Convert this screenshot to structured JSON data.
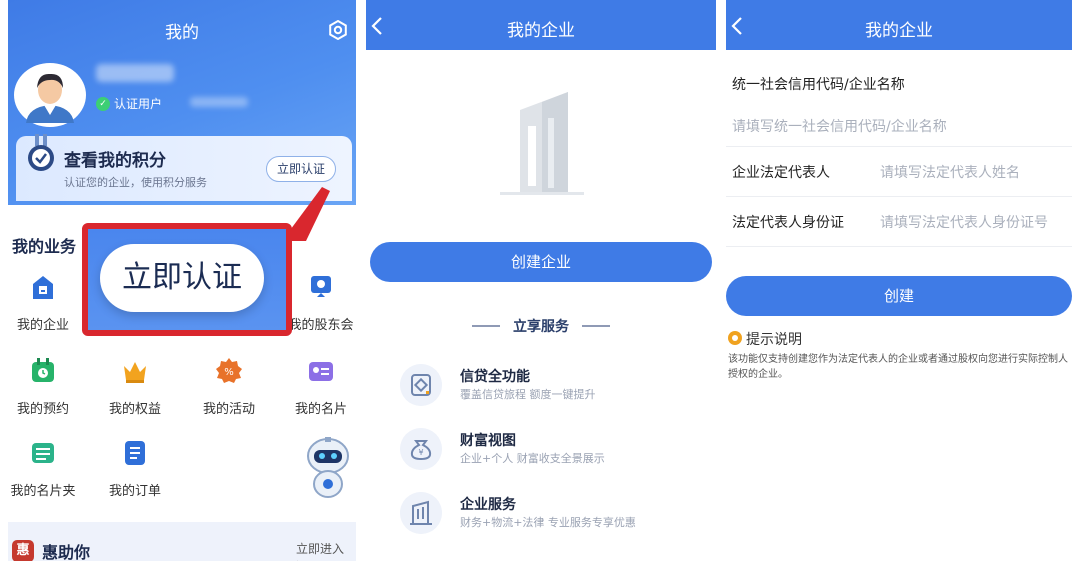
{
  "panel1": {
    "title": "我的",
    "user_badge": "认证用户",
    "points_title": "查看我的积分",
    "points_sub": "认证您的企业，使用积分服务",
    "verify_small": "立即认证",
    "verify_big": "立即认证",
    "biz_title": "我的业务",
    "grid": [
      {
        "label": "我的企业",
        "color": "#2f6fd8"
      },
      {
        "label": "我的股东会",
        "color": "#2f6fd8"
      },
      {
        "label": "我的预约",
        "color": "#27b36a"
      },
      {
        "label": "我的权益",
        "color": "#f2a31f"
      },
      {
        "label": "我的活动",
        "color": "#e8722a"
      },
      {
        "label": "我的名片",
        "color": "#8c6fe6"
      },
      {
        "label": "我的名片夹",
        "color": "#2bb38a"
      },
      {
        "label": "我的订单",
        "color": "#2f6fd8"
      }
    ],
    "hui_icon": "惠",
    "hui_title": "惠助你",
    "hui_link": "立即进入 >"
  },
  "panel2": {
    "title": "我的企业",
    "create_label": "创建企业",
    "services_head": "立享服务",
    "services": [
      {
        "title": "信贷全功能",
        "desc": "覆盖信贷旅程 额度一键提升"
      },
      {
        "title": "财富视图",
        "desc": "企业+个人 财富收支全景展示"
      },
      {
        "title": "企业服务",
        "desc": "财务+物流+法律 专业服务专享优惠"
      }
    ]
  },
  "panel3": {
    "title": "我的企业",
    "field1_label": "统一社会信用代码/企业名称",
    "field1_placeholder": "请填写统一社会信用代码/企业名称",
    "field2_label": "企业法定代表人",
    "field2_placeholder": "请填写法定代表人姓名",
    "field3_label": "法定代表人身份证",
    "field3_placeholder": "请填写法定代表人身份证号",
    "create_label": "创建",
    "tip_title": "提示说明",
    "tip_body": "该功能仅支持创建您作为法定代表人的企业或者通过股权向您进行实际控制人授权的企业。"
  }
}
